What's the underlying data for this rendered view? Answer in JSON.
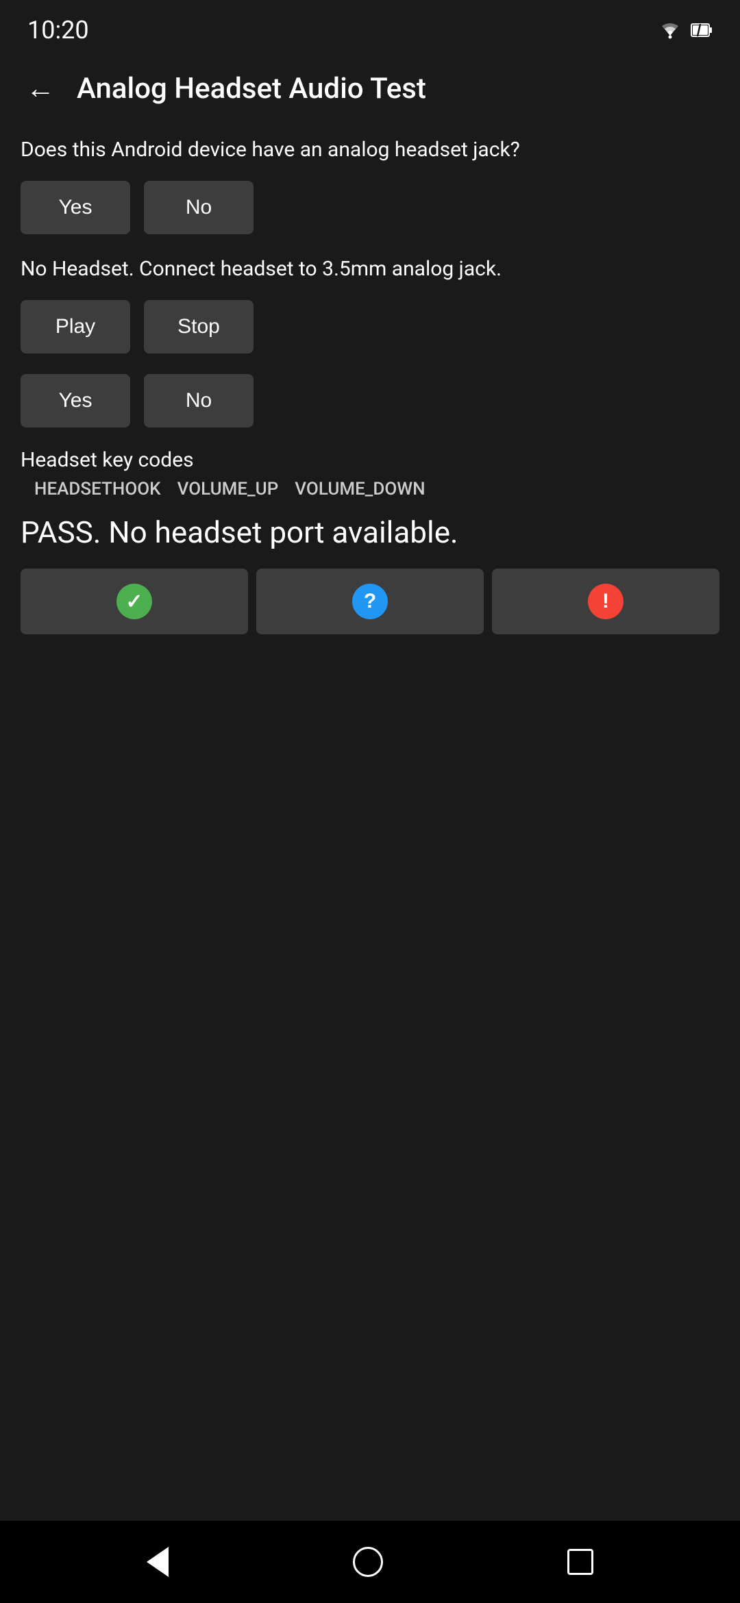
{
  "status_bar": {
    "time": "10:20"
  },
  "header": {
    "title": "Analog Headset Audio Test",
    "back_label": "←"
  },
  "section1": {
    "question": "Does this Android device have an analog headset jack?",
    "yes_label": "Yes",
    "no_label": "No"
  },
  "section2": {
    "info": "No Headset. Connect headset to 3.5mm analog jack.",
    "play_label": "Play",
    "stop_label": "Stop"
  },
  "section3": {
    "yes_label": "Yes",
    "no_label": "No"
  },
  "headset_section": {
    "title": "Headset key codes",
    "codes": [
      "HEADSETHOOK",
      "VOLUME_UP",
      "VOLUME_DOWN"
    ]
  },
  "pass_text": "PASS. No headset port available.",
  "result_buttons": {
    "pass_icon": "✓",
    "question_icon": "?",
    "fail_icon": "!"
  },
  "nav": {
    "back": "",
    "home": "",
    "recents": ""
  }
}
